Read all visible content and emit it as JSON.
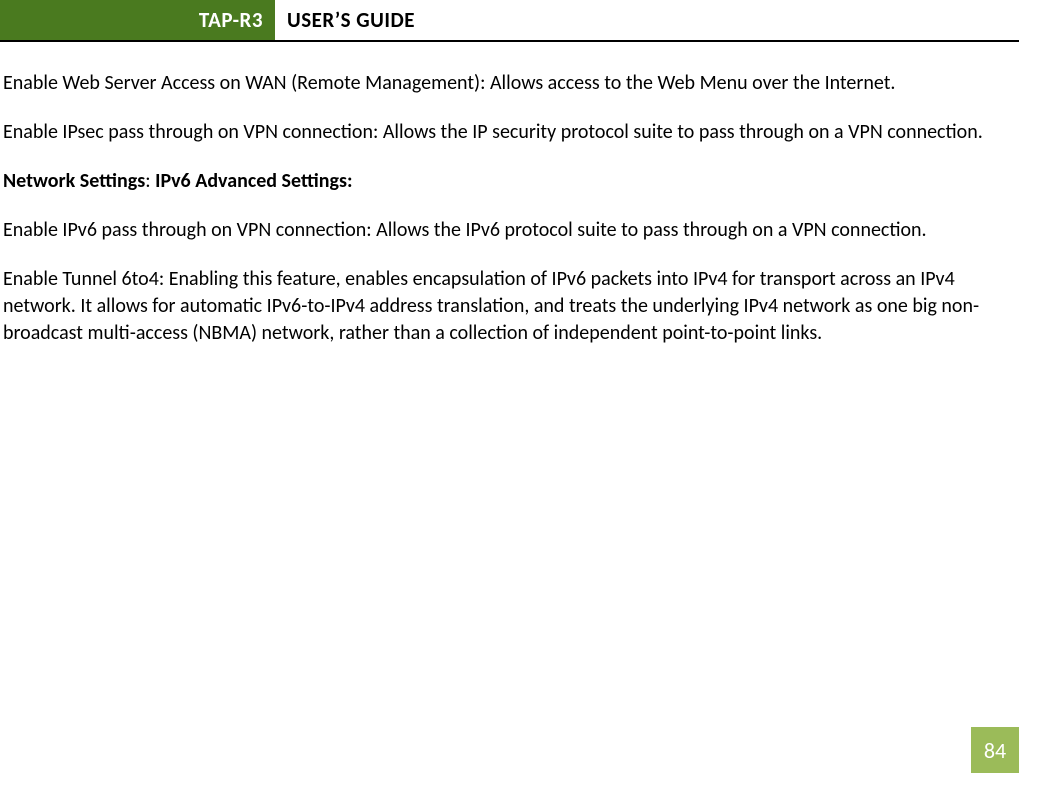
{
  "header": {
    "product": "TAP-R3",
    "title": "USER’S GUIDE"
  },
  "content": {
    "para1": "Enable Web Server Access on WAN (Remote Management): Allows access to the Web Menu over the Internet.",
    "para2": "Enable IPsec pass through on VPN connection: Allows the IP security protocol suite to pass through on a VPN connection.",
    "section_heading_part1": "Network Settings",
    "section_heading_sep": ": ",
    "section_heading_part2": "IPv6 Advanced Settings:",
    "para3": "Enable IPv6 pass through on VPN connection: Allows the IPv6 protocol suite to pass through on a VPN connection.",
    "para4": "Enable Tunnel 6to4:  Enabling this feature, enables encapsulation of IPv6 packets into IPv4 for transport across an IPv4 network.  It allows for automatic IPv6-to-IPv4 address translation, and treats the underlying IPv4 network as one big non-broadcast multi-access (NBMA) network, rather than a collection of independent point-to-point links."
  },
  "page_number": "84"
}
